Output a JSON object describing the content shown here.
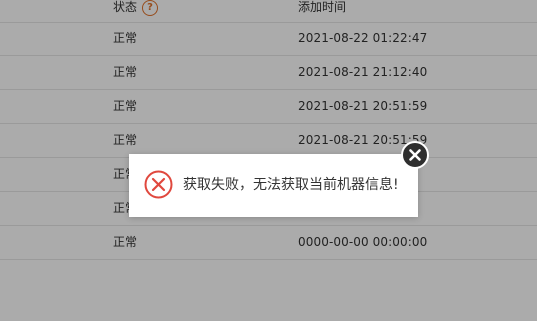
{
  "table": {
    "headers": {
      "status": "状态",
      "time": "添加时间"
    },
    "help_icon": "question-mark",
    "rows": [
      {
        "status": "正常",
        "time": "2021-08-22 01:22:47"
      },
      {
        "status": "正常",
        "time": "2021-08-21 21:12:40"
      },
      {
        "status": "正常",
        "time": "2021-08-21 20:51:59"
      },
      {
        "status": "正常",
        "time": "2021-08-21 20:51:59"
      },
      {
        "status": "正常",
        "time": ""
      },
      {
        "status": "正常",
        "time": ""
      },
      {
        "status": "正常",
        "time": "0000-00-00 00:00:00"
      }
    ]
  },
  "dialog": {
    "message": "获取失败，无法获取当前机器信息!",
    "icon": "error-circle-x",
    "error_color": "#e0483e",
    "close_icon": "close-x"
  },
  "colors": {
    "accent_help": "#e0722a"
  }
}
